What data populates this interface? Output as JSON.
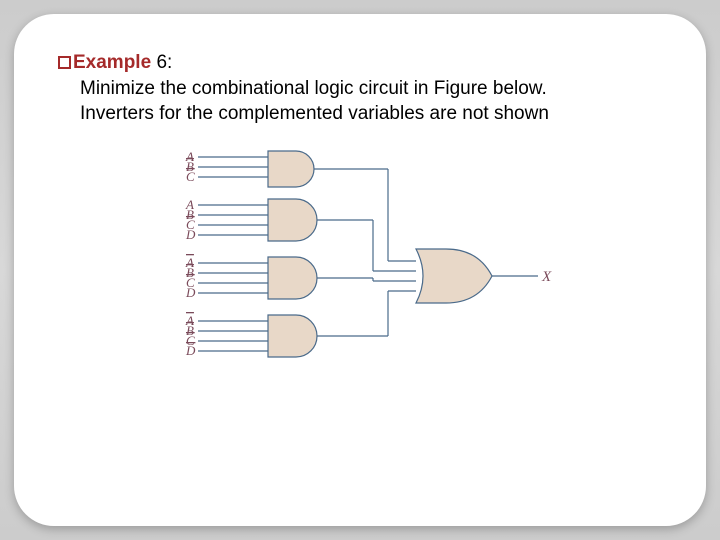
{
  "heading": {
    "bullet_label": "Example",
    "number": "6:"
  },
  "body": "Minimize the combinational logic circuit in Figure below. Inverters for the complemented variables are not shown",
  "circuit": {
    "output_label": "X",
    "gates": [
      {
        "type": "AND",
        "inputs": [
          "A",
          "B̄",
          "C̄"
        ]
      },
      {
        "type": "AND",
        "inputs": [
          "A",
          "B",
          "C̄",
          "D"
        ]
      },
      {
        "type": "AND",
        "inputs": [
          "Ā",
          "B̄",
          "C̄",
          "D"
        ]
      },
      {
        "type": "AND",
        "inputs": [
          "Ā",
          "B̄",
          "C̄",
          "D̄"
        ]
      }
    ],
    "combiner": "OR"
  },
  "chart_data": {
    "type": "diagram",
    "description": "Combinational logic circuit: four AND gates feeding one OR gate",
    "and_gate_inputs": [
      [
        "A",
        "B'",
        "C'"
      ],
      [
        "A",
        "B",
        "C'",
        "D"
      ],
      [
        "A'",
        "B'",
        "C'",
        "D"
      ],
      [
        "A'",
        "B'",
        "C'",
        "D'"
      ]
    ],
    "or_gate_output": "X"
  }
}
